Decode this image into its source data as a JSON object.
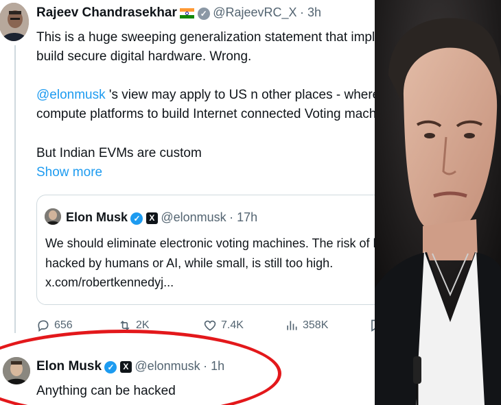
{
  "colors": {
    "accent": "#1d9bf0",
    "text": "#0f1419",
    "muted": "#536471",
    "highlight_oval": "#e3181b"
  },
  "main_tweet": {
    "author_name": "Rajeev Chandrasekhar",
    "flag_icon": "india-flag-icon",
    "handle": "@RajeevRC_X",
    "time": "· 3h",
    "line1": "This is a huge sweeping generalization statement that implies no one c",
    "line2": "build  secure digital hardware. Wrong.",
    "mention": "@elonmusk",
    "line3_rest": " 's view may apply to US n other places - where they use re",
    "line4": "compute platforms to build Internet connected Voting machines.",
    "line5": "But Indian EVMs are custom",
    "show_more": "Show more"
  },
  "quoted_tweet": {
    "author_name": "Elon Musk",
    "handle": "@elonmusk",
    "time": "· 17h",
    "line1": "We should eliminate electronic voting machines. The risk of being",
    "line2": "hacked by humans or AI, while small, is still too high.",
    "line3": "x.com/robertkennedyj..."
  },
  "actions": {
    "replies": "656",
    "reposts": "2K",
    "likes": "7.4K",
    "views": "358K"
  },
  "reply_tweet": {
    "author_name": "Elon Musk",
    "handle": "@elonmusk",
    "time": "· 1h",
    "text": "Anything can be hacked"
  }
}
